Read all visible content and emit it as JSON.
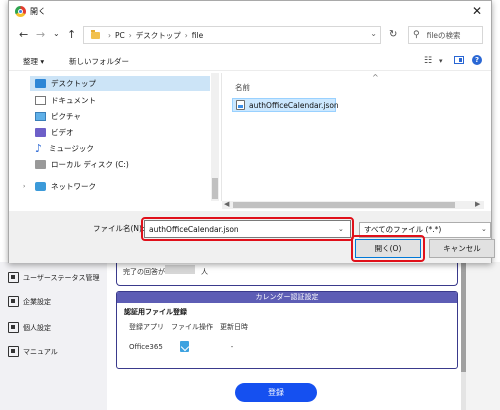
{
  "background": {
    "sidebar": [
      {
        "label": "ユーザーステータス管理",
        "icon": "user-status-icon"
      },
      {
        "label": "企業設定",
        "icon": "company-icon"
      },
      {
        "label": "個人設定",
        "icon": "person-icon"
      },
      {
        "label": "マニュアル",
        "icon": "manual-icon"
      }
    ],
    "top_panel_text": "完了の回答が",
    "top_panel_suffix": "人",
    "calendar_panel": {
      "header": "カレンダー認証設定",
      "subheading": "認証用ファイル登録",
      "columns": [
        "登録アプリ",
        "ファイル操作",
        "更新日時"
      ],
      "row": {
        "app": "Office365",
        "file_op_icon": "upload-file-icon",
        "updated": "-"
      }
    },
    "register_button": "登録"
  },
  "dialog": {
    "title": "開く",
    "close": "✕",
    "nav": {
      "back": "←",
      "forward": "→",
      "dropdown": "⌄",
      "up": "↑"
    },
    "breadcrumb": [
      "PC",
      "デスクトップ",
      "file"
    ],
    "refresh": "↻",
    "search_placeholder": "fileの検索",
    "toolbar": {
      "organize": "整理 ▾",
      "new_folder": "新しいフォルダー"
    },
    "tree": [
      {
        "label": "デスクトップ",
        "icon": "desktop-icon",
        "selected": true
      },
      {
        "label": "ドキュメント",
        "icon": "documents-icon"
      },
      {
        "label": "ピクチャ",
        "icon": "pictures-icon"
      },
      {
        "label": "ビデオ",
        "icon": "videos-icon"
      },
      {
        "label": "ミュージック",
        "icon": "music-icon"
      },
      {
        "label": "ローカル ディスク (C:)",
        "icon": "disk-icon"
      },
      {
        "label": "ネットワーク",
        "icon": "network-icon"
      }
    ],
    "file_list": {
      "column_header": "名前",
      "files": [
        {
          "name": "authOfficeCalendar.json",
          "icon": "json-file-icon",
          "selected": true
        }
      ]
    },
    "footer": {
      "filename_label": "ファイル名(N):",
      "filename_value": "authOfficeCalendar.json",
      "filetype_value": "すべてのファイル (*.*)",
      "open_button": "開く(O)",
      "cancel_button": "キャンセル"
    }
  },
  "colors": {
    "highlight_red": "#e0101a",
    "register_blue": "#1550f0",
    "panel_header": "#5d5db5"
  }
}
